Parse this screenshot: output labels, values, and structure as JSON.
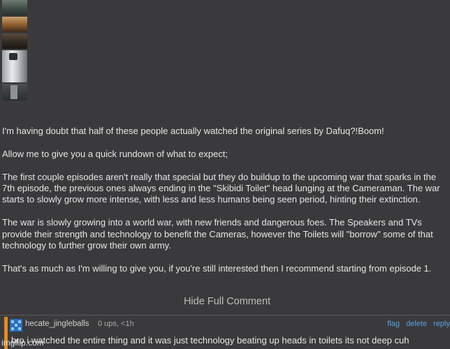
{
  "comment": {
    "paragraphs": [
      "I'm having doubt that half of these people actually watched the original series by Dafuq?!Boom!",
      "Allow me to give you a quick rundown of what to expect;",
      "The first couple episodes aren't really that special but they do buildup to the upcoming war that sparks in the 7th episode, the previous ones always ending in the \"Skibidi Toilet\" head lunging at the Cameraman. The war starts to slowly grow more intense, with less and less humans being seen period, hinting their extinction.",
      "The war is slowly growing into a world war, with new friends and dangerous foes. The Speakers and TVs provide their strength and technology to benefit the Cameras, however the Toilets will \"borrow\" some of that technology to further grow their own army.",
      "That's as much as I'm willing to give you, if you're still interested then I recommend starting from episode 1."
    ],
    "toggle_label": "Hide Full Comment"
  },
  "reply": {
    "username": "hecate_jingleballs",
    "meta": "0 ups, <1h",
    "actions": [
      "flag",
      "delete",
      "reply"
    ],
    "text": "bro i watched the entire thing and it was just technology beating up heads in toilets its not deep cuh",
    "accent_color": "#e58a1f"
  },
  "watermark": "imgflip.com"
}
